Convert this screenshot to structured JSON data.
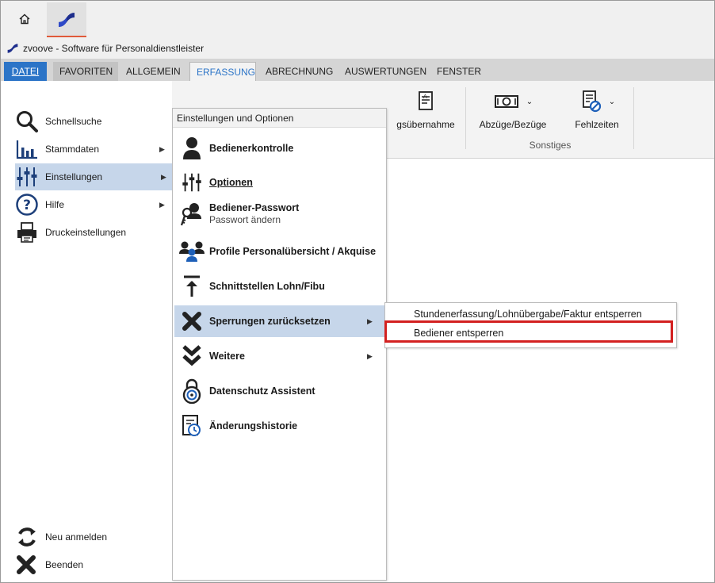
{
  "app": {
    "title": "zvoove - Software für Personaldienstleister",
    "accent_color": "#2b74c7",
    "tab_underline_color": "#e05a3a"
  },
  "ribbon": {
    "tabs": [
      "DATEI",
      "FAVORITEN",
      "ALLGEMEIN",
      "ERFASSUNG",
      "ABRECHNUNG",
      "AUSWERTUNGEN",
      "FENSTER"
    ],
    "active_tab": "ERFASSUNG",
    "buttons": [
      {
        "label": "gsübernahme",
        "icon": "document-transfer-icon"
      },
      {
        "label": "Abzüge/Bezüge",
        "icon": "money-bill-icon"
      },
      {
        "label": "Fehlzeiten",
        "icon": "document-blocked-icon"
      }
    ],
    "group_label": "Sonstiges"
  },
  "backstage": {
    "items": [
      {
        "label": "Schnellsuche",
        "icon": "magnifier-icon",
        "has_arrow": false
      },
      {
        "label": "Stammdaten",
        "icon": "bar-chart-icon",
        "has_arrow": true
      },
      {
        "label": "Einstellungen",
        "icon": "sliders-icon",
        "has_arrow": true,
        "active": true
      },
      {
        "label": "Hilfe",
        "icon": "help-icon",
        "has_arrow": true
      },
      {
        "label": "Druckeinstellungen",
        "icon": "printer-icon",
        "has_arrow": false
      }
    ],
    "bottom_items": [
      {
        "label": "Neu anmelden",
        "icon": "refresh-icon"
      },
      {
        "label": "Beenden",
        "icon": "close-x-icon"
      }
    ]
  },
  "submenu": {
    "header": "Einstellungen und Optionen",
    "items": [
      {
        "label": "Bedienerkontrolle",
        "icon": "user-icon"
      },
      {
        "label": "Optionen",
        "icon": "sliders-icon"
      },
      {
        "label": "Bediener-Passwort",
        "sublabel": "Passwort ändern",
        "icon": "key-user-icon"
      },
      {
        "label": "Profile Personalübersicht / Akquise",
        "icon": "group-icon"
      },
      {
        "label": "Schnittstellen Lohn/Fibu",
        "icon": "upload-arrow-icon"
      },
      {
        "label": "Sperrungen zurücksetzen",
        "icon": "close-x-icon",
        "has_arrow": true,
        "active": true
      },
      {
        "label": "Weitere",
        "icon": "double-chevron-icon",
        "has_arrow": true
      },
      {
        "label": "Datenschutz Assistent",
        "icon": "privacy-lock-icon"
      },
      {
        "label": "Änderungshistorie",
        "icon": "history-icon"
      }
    ]
  },
  "flyout": {
    "items": [
      {
        "label": "Stundenerfassung/Lohnübergabe/Faktur entsperren"
      },
      {
        "label": "Bediener entsperren",
        "highlighted": true
      }
    ],
    "highlight_color": "#d32020"
  }
}
